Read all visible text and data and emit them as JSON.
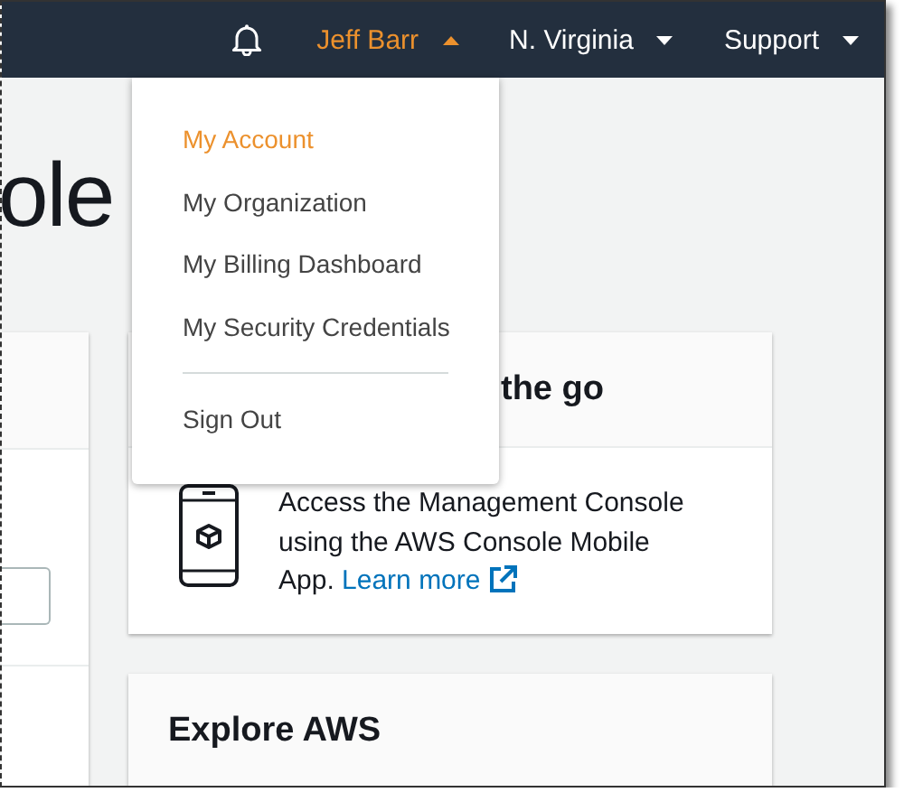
{
  "top_bar": {
    "menus": [
      {
        "label": "Jeff Barr",
        "expanded": true
      },
      {
        "label": "N. Virginia",
        "expanded": false
      },
      {
        "label": "Support",
        "expanded": false
      }
    ]
  },
  "account_dropdown": {
    "items": [
      {
        "kind": "item",
        "label": "My Account",
        "selected": true
      },
      {
        "kind": "item",
        "label": "My Organization",
        "selected": false
      },
      {
        "kind": "item",
        "label": "My Billing Dashboard",
        "selected": false
      },
      {
        "kind": "item",
        "label": "My Security Credentials",
        "selected": false
      },
      {
        "kind": "divider"
      },
      {
        "kind": "item",
        "label": "Sign Out",
        "selected": false
      }
    ]
  },
  "page_title": "ole",
  "mobile_card": {
    "title": "the go",
    "text": "Access the Management Console using the AWS Console Mobile App.",
    "link": "Learn more"
  },
  "explore_card": {
    "title": "Explore AWS"
  }
}
